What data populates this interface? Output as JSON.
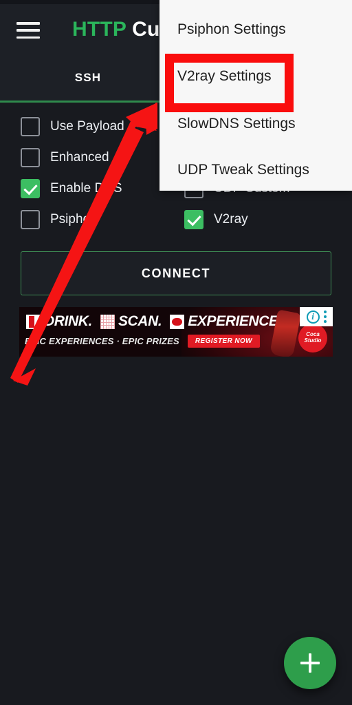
{
  "app": {
    "title_primary": "HTTP",
    "title_secondary": "Custom"
  },
  "appbar": {
    "menu_icon": "hamburger-menu-icon"
  },
  "tabs": [
    {
      "label": "SSH",
      "selected": true
    }
  ],
  "options": {
    "left_column": [
      {
        "label": "Use Payload",
        "checked": false
      },
      {
        "label": "Enhanced",
        "checked": false
      },
      {
        "label": "Enable DNS",
        "checked": true
      },
      {
        "label": "Psiphon",
        "checked": false
      }
    ],
    "right_column": [
      {
        "label": "UDP Custom",
        "checked": false
      },
      {
        "label": "V2ray",
        "checked": true
      }
    ]
  },
  "connect": {
    "label": "CONNECT"
  },
  "ad": {
    "word1": "DRINK.",
    "word2": "SCAN.",
    "word3": "EXPERIENCE.",
    "subline": "EPIC EXPERIENCES · EPIC PRIZES",
    "cta": "REGISTER NOW",
    "brand_badge": "Coca Studio",
    "info_glyph": "i"
  },
  "fab": {
    "icon": "plus-icon"
  },
  "menu": {
    "items": [
      {
        "label": "Psiphon Settings",
        "highlighted": false
      },
      {
        "label": "V2ray Settings",
        "highlighted": true
      },
      {
        "label": "SlowDNS Settings",
        "highlighted": false
      },
      {
        "label": "UDP Tweak Settings",
        "highlighted": false
      }
    ]
  },
  "annotation": {
    "highlight_color": "#fa0d0d",
    "arrow_color": "#f51414",
    "arrow_target": "V2ray Settings"
  },
  "colors": {
    "background": "#181a1f",
    "surface": "#1d2026",
    "accent_green": "#2bb55b",
    "checkbox_on": "#3cbe62",
    "menu_surface": "#f7f7f7",
    "fab": "#2e9e4b"
  }
}
